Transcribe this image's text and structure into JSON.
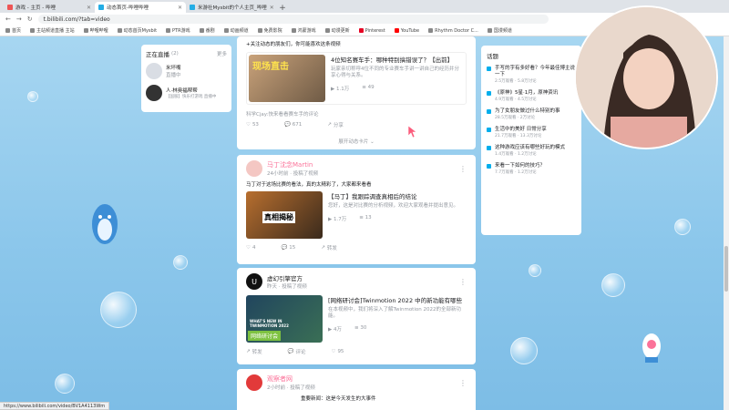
{
  "browser": {
    "tabs": [
      {
        "title": "游戏 - 主页 - 哔哩",
        "active": false
      },
      {
        "title": "动态首页-哔哩哔哩",
        "active": true
      },
      {
        "title": "米游社Mysbit的个人主页_哔哩",
        "active": false
      }
    ],
    "url": "t.bilibili.com/?tab=video",
    "bookmarks": [
      "首页",
      "主站频道直播 主站",
      "哔哩哔哩",
      "动态首页Mysbit",
      "PTR游戏",
      "番剧",
      "动画频道",
      "免费影院",
      "鸿蒙游戏",
      "动漫更新",
      "Pinterest",
      "YouTube",
      "Rhythm Doctor C...",
      "国漫频道"
    ]
  },
  "left_panel": {
    "title": "正在直播",
    "count": "(2)",
    "more": "更多",
    "items": [
      {
        "name": "米坏嘴",
        "sub": "直播中"
      },
      {
        "name": "人·林奥福帮帮",
        "sub": "【国服】快乐打游戏 直播中"
      }
    ]
  },
  "feed": {
    "card1": {
      "top_text": "+关注动态的朋友们，你可能喜欢这条视频",
      "thumb_text": "现场直击",
      "video_title": "4位知名赛车手：哪种特别搞错误了？【出前】",
      "video_desc": "玩家亲切称呼4位不同的专业赛车手讲一讲自己的经历并分享心得与关系。",
      "stat1": "1.1万",
      "stat2": "49",
      "comment_user": "科学Cjay:快来看看赛车手的评论",
      "likes": "53",
      "comments": "671",
      "shares": "分享",
      "expand": "展开动态卡片"
    },
    "card2": {
      "name": "马丁沈念Martin",
      "time": "24小时前 · 投稿了视频",
      "text": "马丁对于这场比赛的看法，真的太精彩了，大家都来看看",
      "thumb_label": "真相揭秘",
      "video_title": "【马丁】我跟踪调查真相后的结论",
      "video_desc": "您好，这是对比赛的分析视频，欢迎大家观看并提出意见。",
      "stat1": "1.7万",
      "stat2": "13",
      "likes": "4",
      "comments": "15",
      "shares": "转发"
    },
    "card3": {
      "name": "虚幻引擎官方",
      "time": "昨天 · 投稿了视频",
      "thumb_label": "网络研讨会",
      "thumb_banner": "WHAT'S NEW IN TWINMOTION 2022",
      "video_title": "[网络研讨会]Twinmotion 2022 中的新功能有哪些",
      "video_desc": "在本视频中，我们将深入了解Twinmotion 2022的全部新功能。",
      "stat1": "4万",
      "stat2": "30",
      "likes": "转发",
      "comments": "评论",
      "shares": "95"
    },
    "card4": {
      "name": "观察者网",
      "time": "2小时前 · 投稿了视频",
      "text": "重要新闻：这是今天发生的大事件"
    }
  },
  "right_panel": {
    "title": "话题",
    "items": [
      {
        "title": "手写的字有多好看？今年最佳博主说一下",
        "sub": "2.5万观看 · 5.8万讨论"
      },
      {
        "title": "《原神》5星·1月，原神资讯",
        "sub": "4.9万观看 · 4.5万讨论"
      },
      {
        "title": "为了女朋友做过什么特别的事",
        "sub": "28.5万观看 · 2万讨论"
      },
      {
        "title": "生活中的美好 日常分享",
        "sub": "21.7万观看 · 13.3万讨论"
      },
      {
        "title": "这种游戏应该有哪些好玩的模式",
        "sub": "1.4万观看 · 1.2万讨论"
      },
      {
        "title": "来看一下如何的技巧？",
        "sub": "7.7万观看 · 1.2万讨论"
      }
    ]
  },
  "status_url": "https://www.bilibili.com/video/BV1A4113Wm",
  "colors": {
    "accent": "#00aeec",
    "pink": "#fb7299",
    "sky": "#8cc7eb"
  }
}
